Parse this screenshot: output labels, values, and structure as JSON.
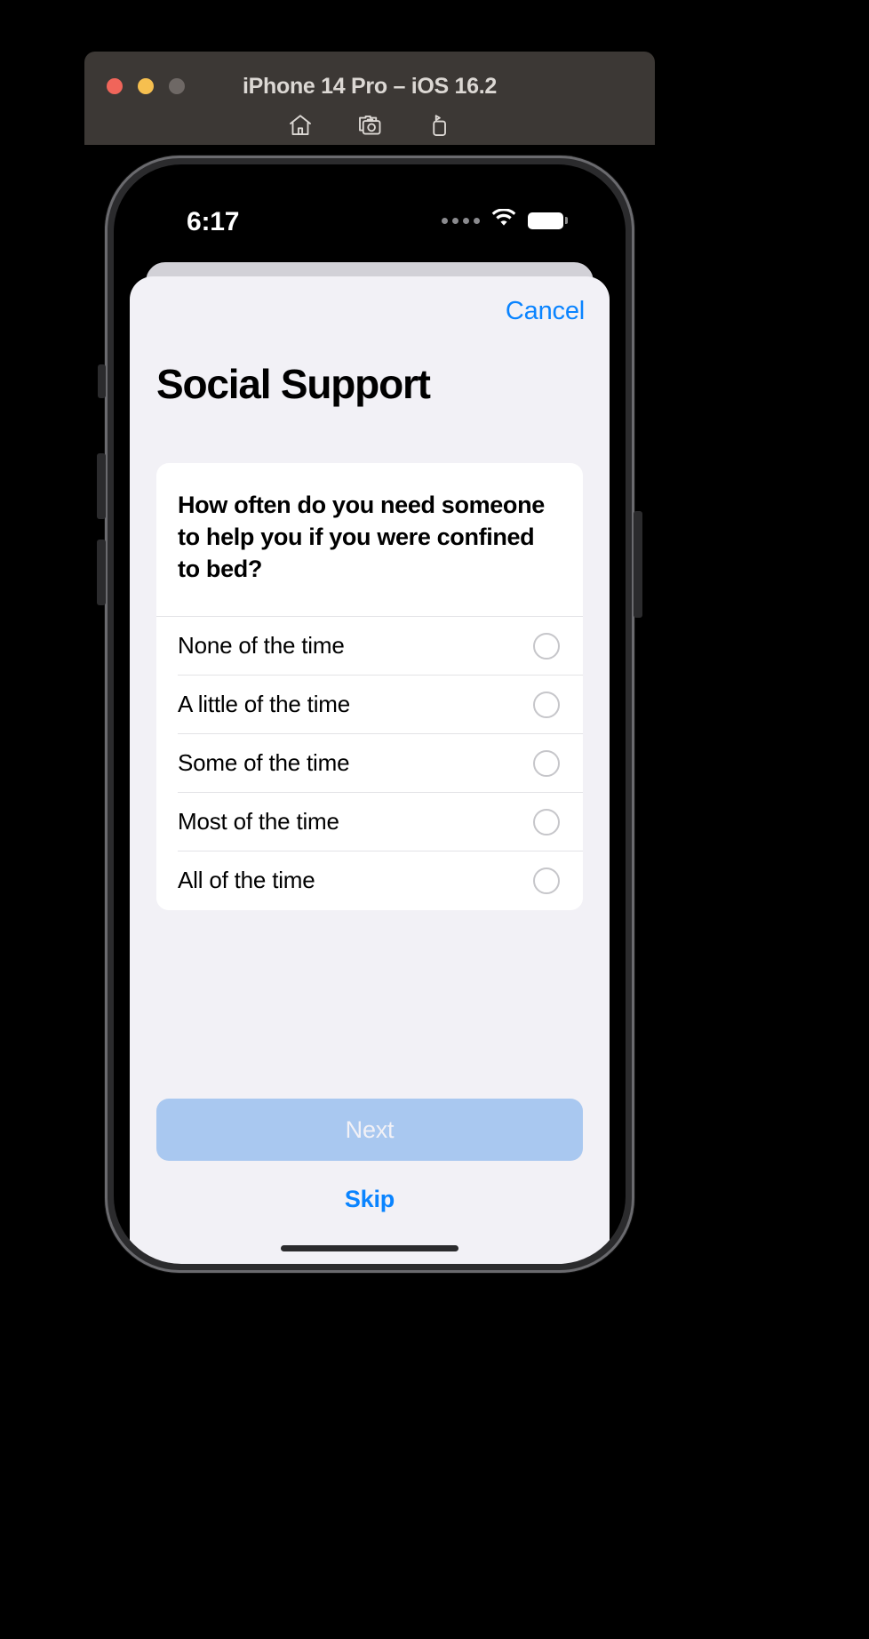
{
  "window": {
    "title": "iPhone 14 Pro – iOS 16.2",
    "traffic_lights": [
      {
        "name": "close",
        "color": "#F0655A"
      },
      {
        "name": "minimize",
        "color": "#F6BF4F"
      },
      {
        "name": "zoom",
        "color": "#6E6865"
      }
    ],
    "toolbar_icons": [
      {
        "name": "home-icon",
        "label": "Home"
      },
      {
        "name": "screenshot-icon",
        "label": "Screenshot"
      },
      {
        "name": "rotate-icon",
        "label": "Rotate"
      }
    ]
  },
  "status_bar": {
    "time": "6:17",
    "cellular_icon": "cellular-signal-icon",
    "wifi_icon": "wifi-icon",
    "battery_icon": "battery-icon"
  },
  "sheet": {
    "cancel_label": "Cancel",
    "title": "Social Support",
    "question": "How often do you need someone to help you if you were confined to bed?",
    "options": [
      {
        "label": "None of the time",
        "selected": false
      },
      {
        "label": "A little of the time",
        "selected": false
      },
      {
        "label": "Some of the time",
        "selected": false
      },
      {
        "label": "Most of the time",
        "selected": false
      },
      {
        "label": "All of the time",
        "selected": false
      }
    ],
    "next_label": "Next",
    "next_enabled": false,
    "skip_label": "Skip"
  },
  "colors": {
    "accent_blue": "#0A84FF",
    "disabled_button": "#A9C8F0",
    "sheet_background": "#F2F1F6",
    "card_background": "#FFFFFF",
    "separator": "#E3E3E6",
    "window_chrome": "#3C3835"
  }
}
